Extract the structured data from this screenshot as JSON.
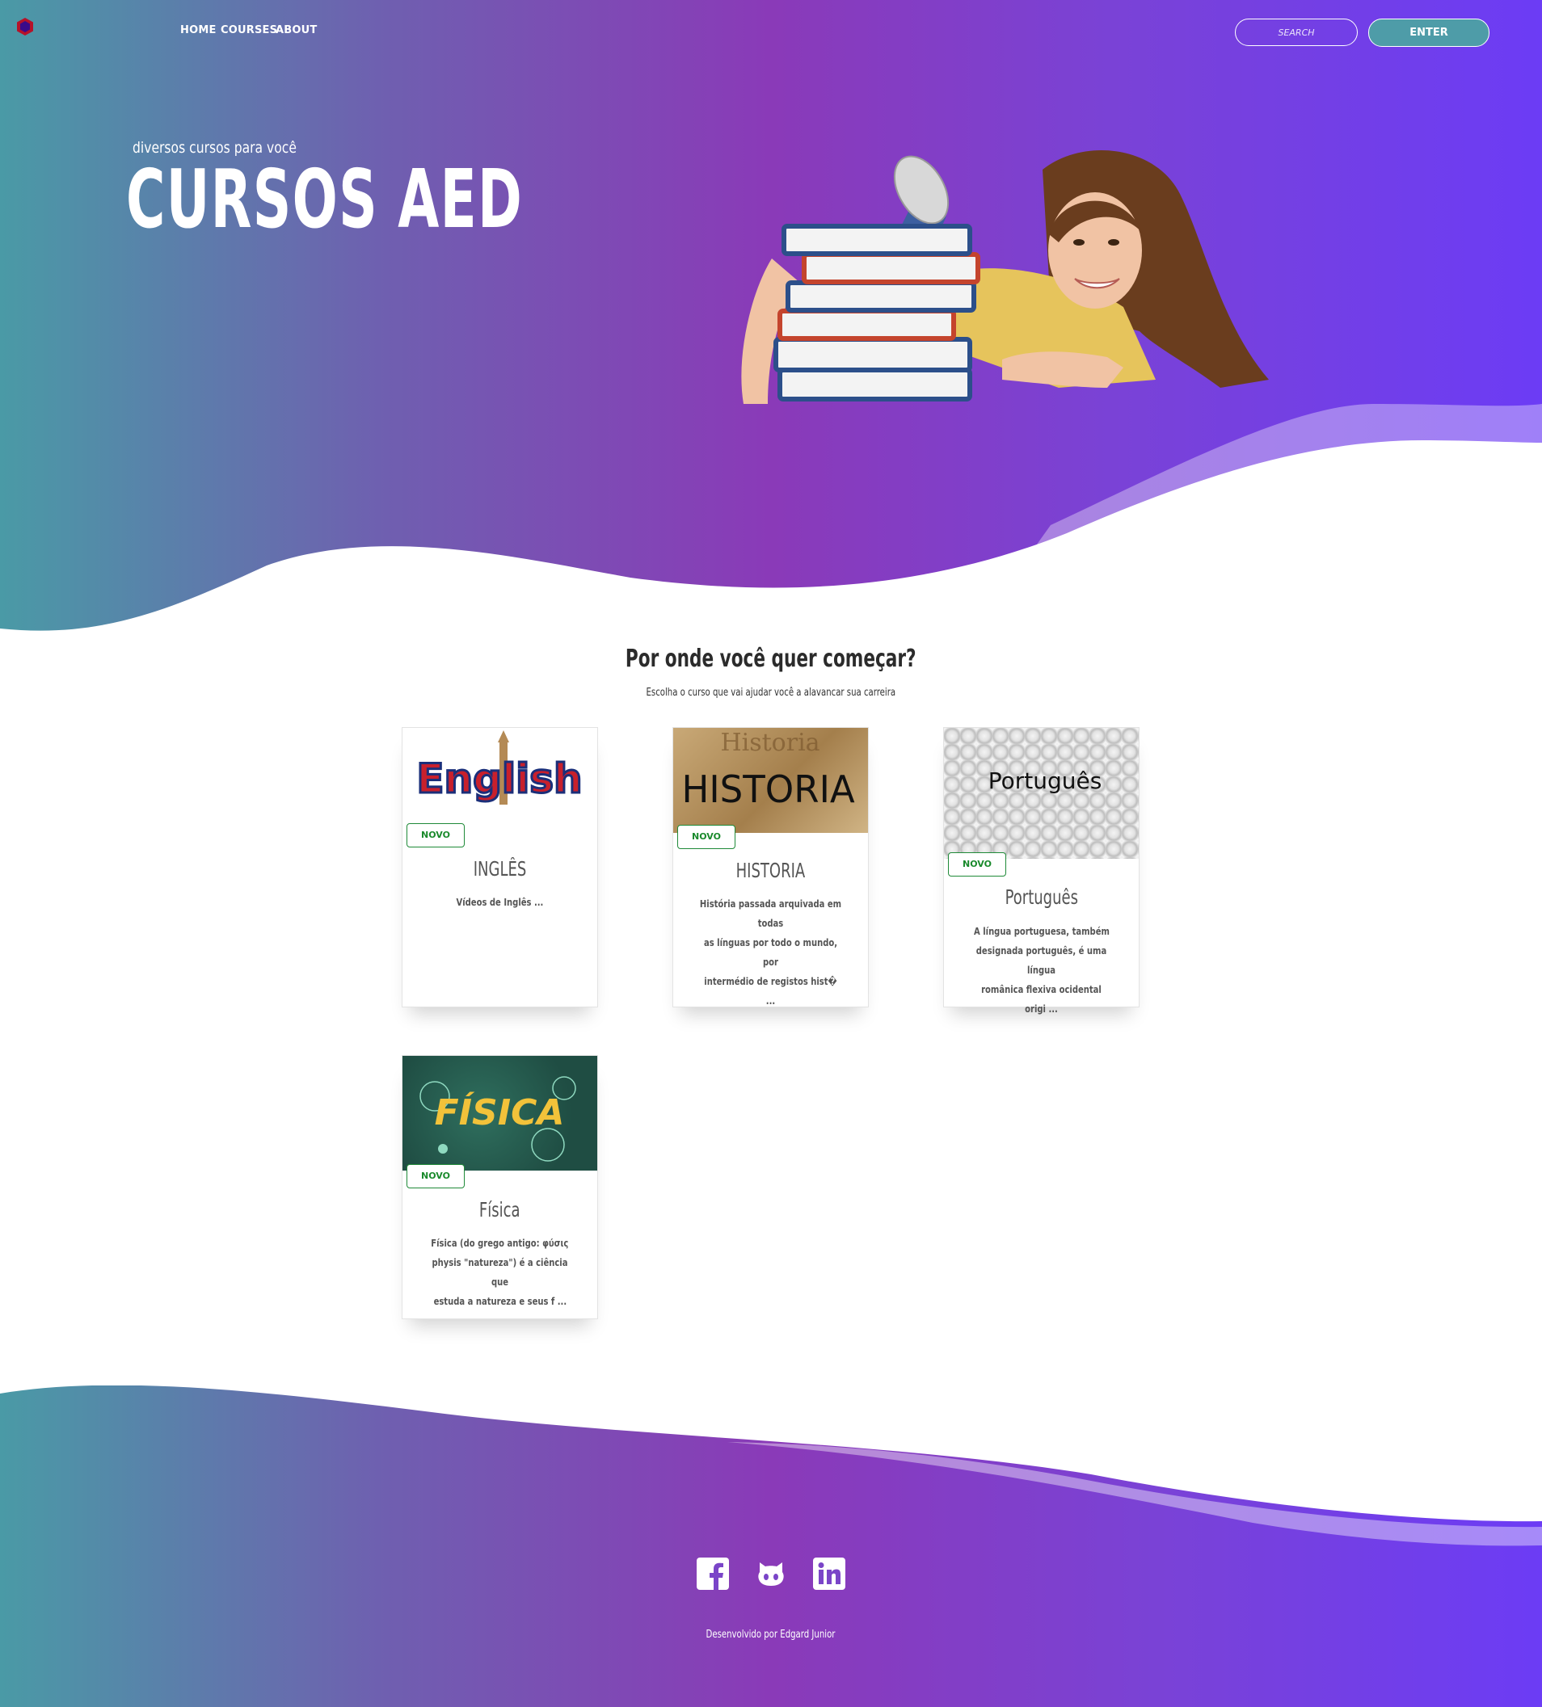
{
  "nav": {
    "links": [
      "HOME",
      "COURSES",
      "ABOUT"
    ],
    "search_placeholder": "SEARCH",
    "enter_label": "ENTER"
  },
  "hero": {
    "subtitle": "diversos cursos para você",
    "title": "CURSOS AED"
  },
  "courses": {
    "heading": "Por onde você quer começar?",
    "subheading": "Escolha o curso que vai ajudar você a alavancar sua carreira",
    "badge": "NOVO",
    "items": [
      {
        "title": "INGLÊS",
        "image_text": "English",
        "desc_lines": [
          "Vídeos de Inglês ..."
        ]
      },
      {
        "title": "HISTORIA",
        "image_text": "HISTORIA",
        "image_text_2": "Historia",
        "desc_lines": [
          "História passada arquivada em todas",
          "as línguas por todo o mundo, por",
          "intermédio de registos hist� ..."
        ]
      },
      {
        "title": "Português",
        "image_text": "Português",
        "desc_lines": [
          "A língua portuguesa, também",
          "designada português, é uma língua",
          "românica flexiva ocidental origi ..."
        ]
      },
      {
        "title": "Física",
        "image_text": "FÍSICA",
        "desc_lines": [
          "Física (do grego antigo: φύσις",
          "physis \"natureza\") é a ciência que",
          "estuda a natureza e seus f ..."
        ]
      }
    ]
  },
  "footer": {
    "social": [
      "facebook-icon",
      "github-icon",
      "linkedin-icon"
    ],
    "credit": "Desenvolvido por Edgard Junior"
  },
  "colors": {
    "gradient_start": "#4a9aa6",
    "gradient_mid": "#8a3ab8",
    "gradient_end": "#6c3cf5",
    "badge_green": "#1f8a38"
  }
}
